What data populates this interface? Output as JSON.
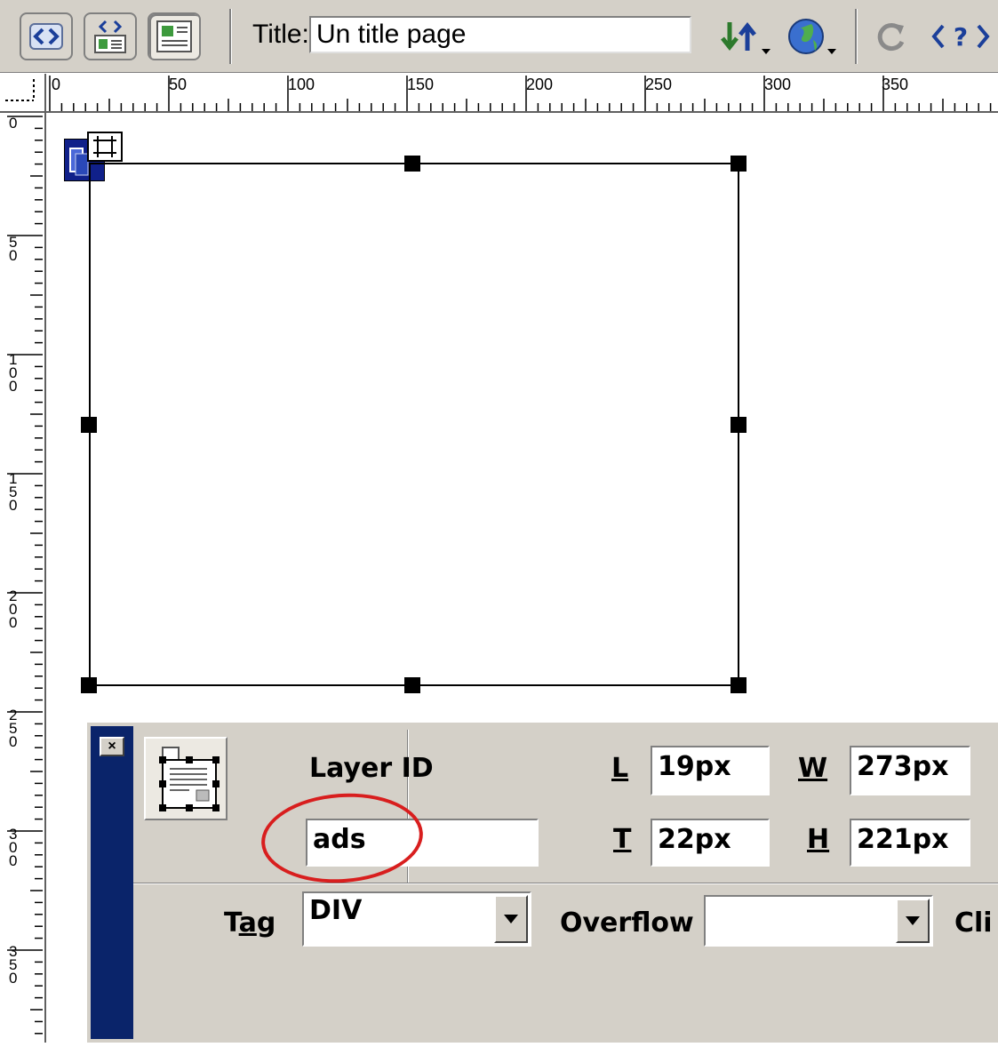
{
  "toolbar": {
    "title_label": "Title:",
    "title_value": "Un title page",
    "buttons": [
      "code-view-icon",
      "split-view-icon",
      "design-view-icon"
    ],
    "right_icons": [
      "file-management-icon",
      "preview-globe-icon",
      "refresh-icon",
      "code-navigation-icon"
    ]
  },
  "ruler": {
    "horizontal_labels": [
      "0",
      "50",
      "100",
      "150",
      "200",
      "250",
      "300",
      "350"
    ],
    "vertical_labels": [
      "0",
      "50",
      "100",
      "150",
      "200",
      "250",
      "300",
      "350"
    ]
  },
  "inspector": {
    "layer_id_label": "Layer ID",
    "layer_id_value": "ads",
    "l_label": "L",
    "l_value": "19px",
    "t_label": "T",
    "t_value": "22px",
    "w_label": "W",
    "w_value": "273px",
    "h_label": "H",
    "h_value": "221px",
    "tag_label_pre": "T",
    "tag_label_ul": "a",
    "tag_label_post": "g",
    "tag_value": "DIV",
    "overflow_label": "Overflow",
    "overflow_value": "",
    "clip_label": "Cli",
    "close_label": "×"
  },
  "annotation": {
    "color": "#d81e1e"
  }
}
